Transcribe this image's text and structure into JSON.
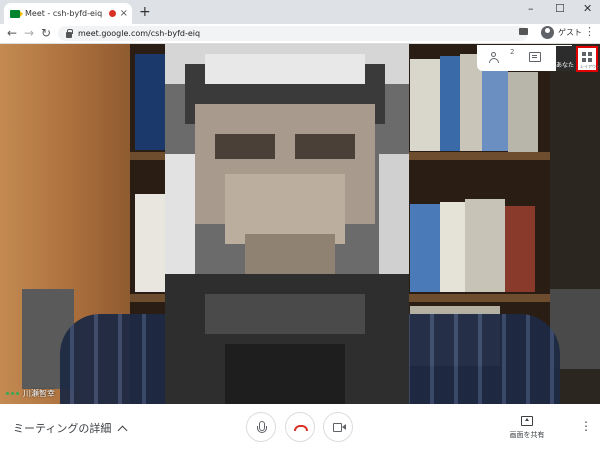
{
  "browser": {
    "tab_title": "Meet - csh-byfd-eiq",
    "new_tab": "+",
    "tab_close": "×",
    "url": "meet.google.com/csh-byfd-eiq",
    "profile_label": "ゲスト",
    "window_controls": {
      "minimize": "–",
      "maximize": "☐",
      "close": "✕"
    },
    "nav": {
      "back": "←",
      "forward": "→",
      "reload": "↻"
    },
    "menu": "⋮"
  },
  "meet": {
    "people_count": "2",
    "self_thumb_label": "あなた",
    "layout_label": "レイアウト",
    "speaker_name": "川瀬智幸",
    "meeting_details": "ミーティングの詳細",
    "present_label": "画面を共有",
    "more": "⋮",
    "highlight_color": "#e00000"
  }
}
